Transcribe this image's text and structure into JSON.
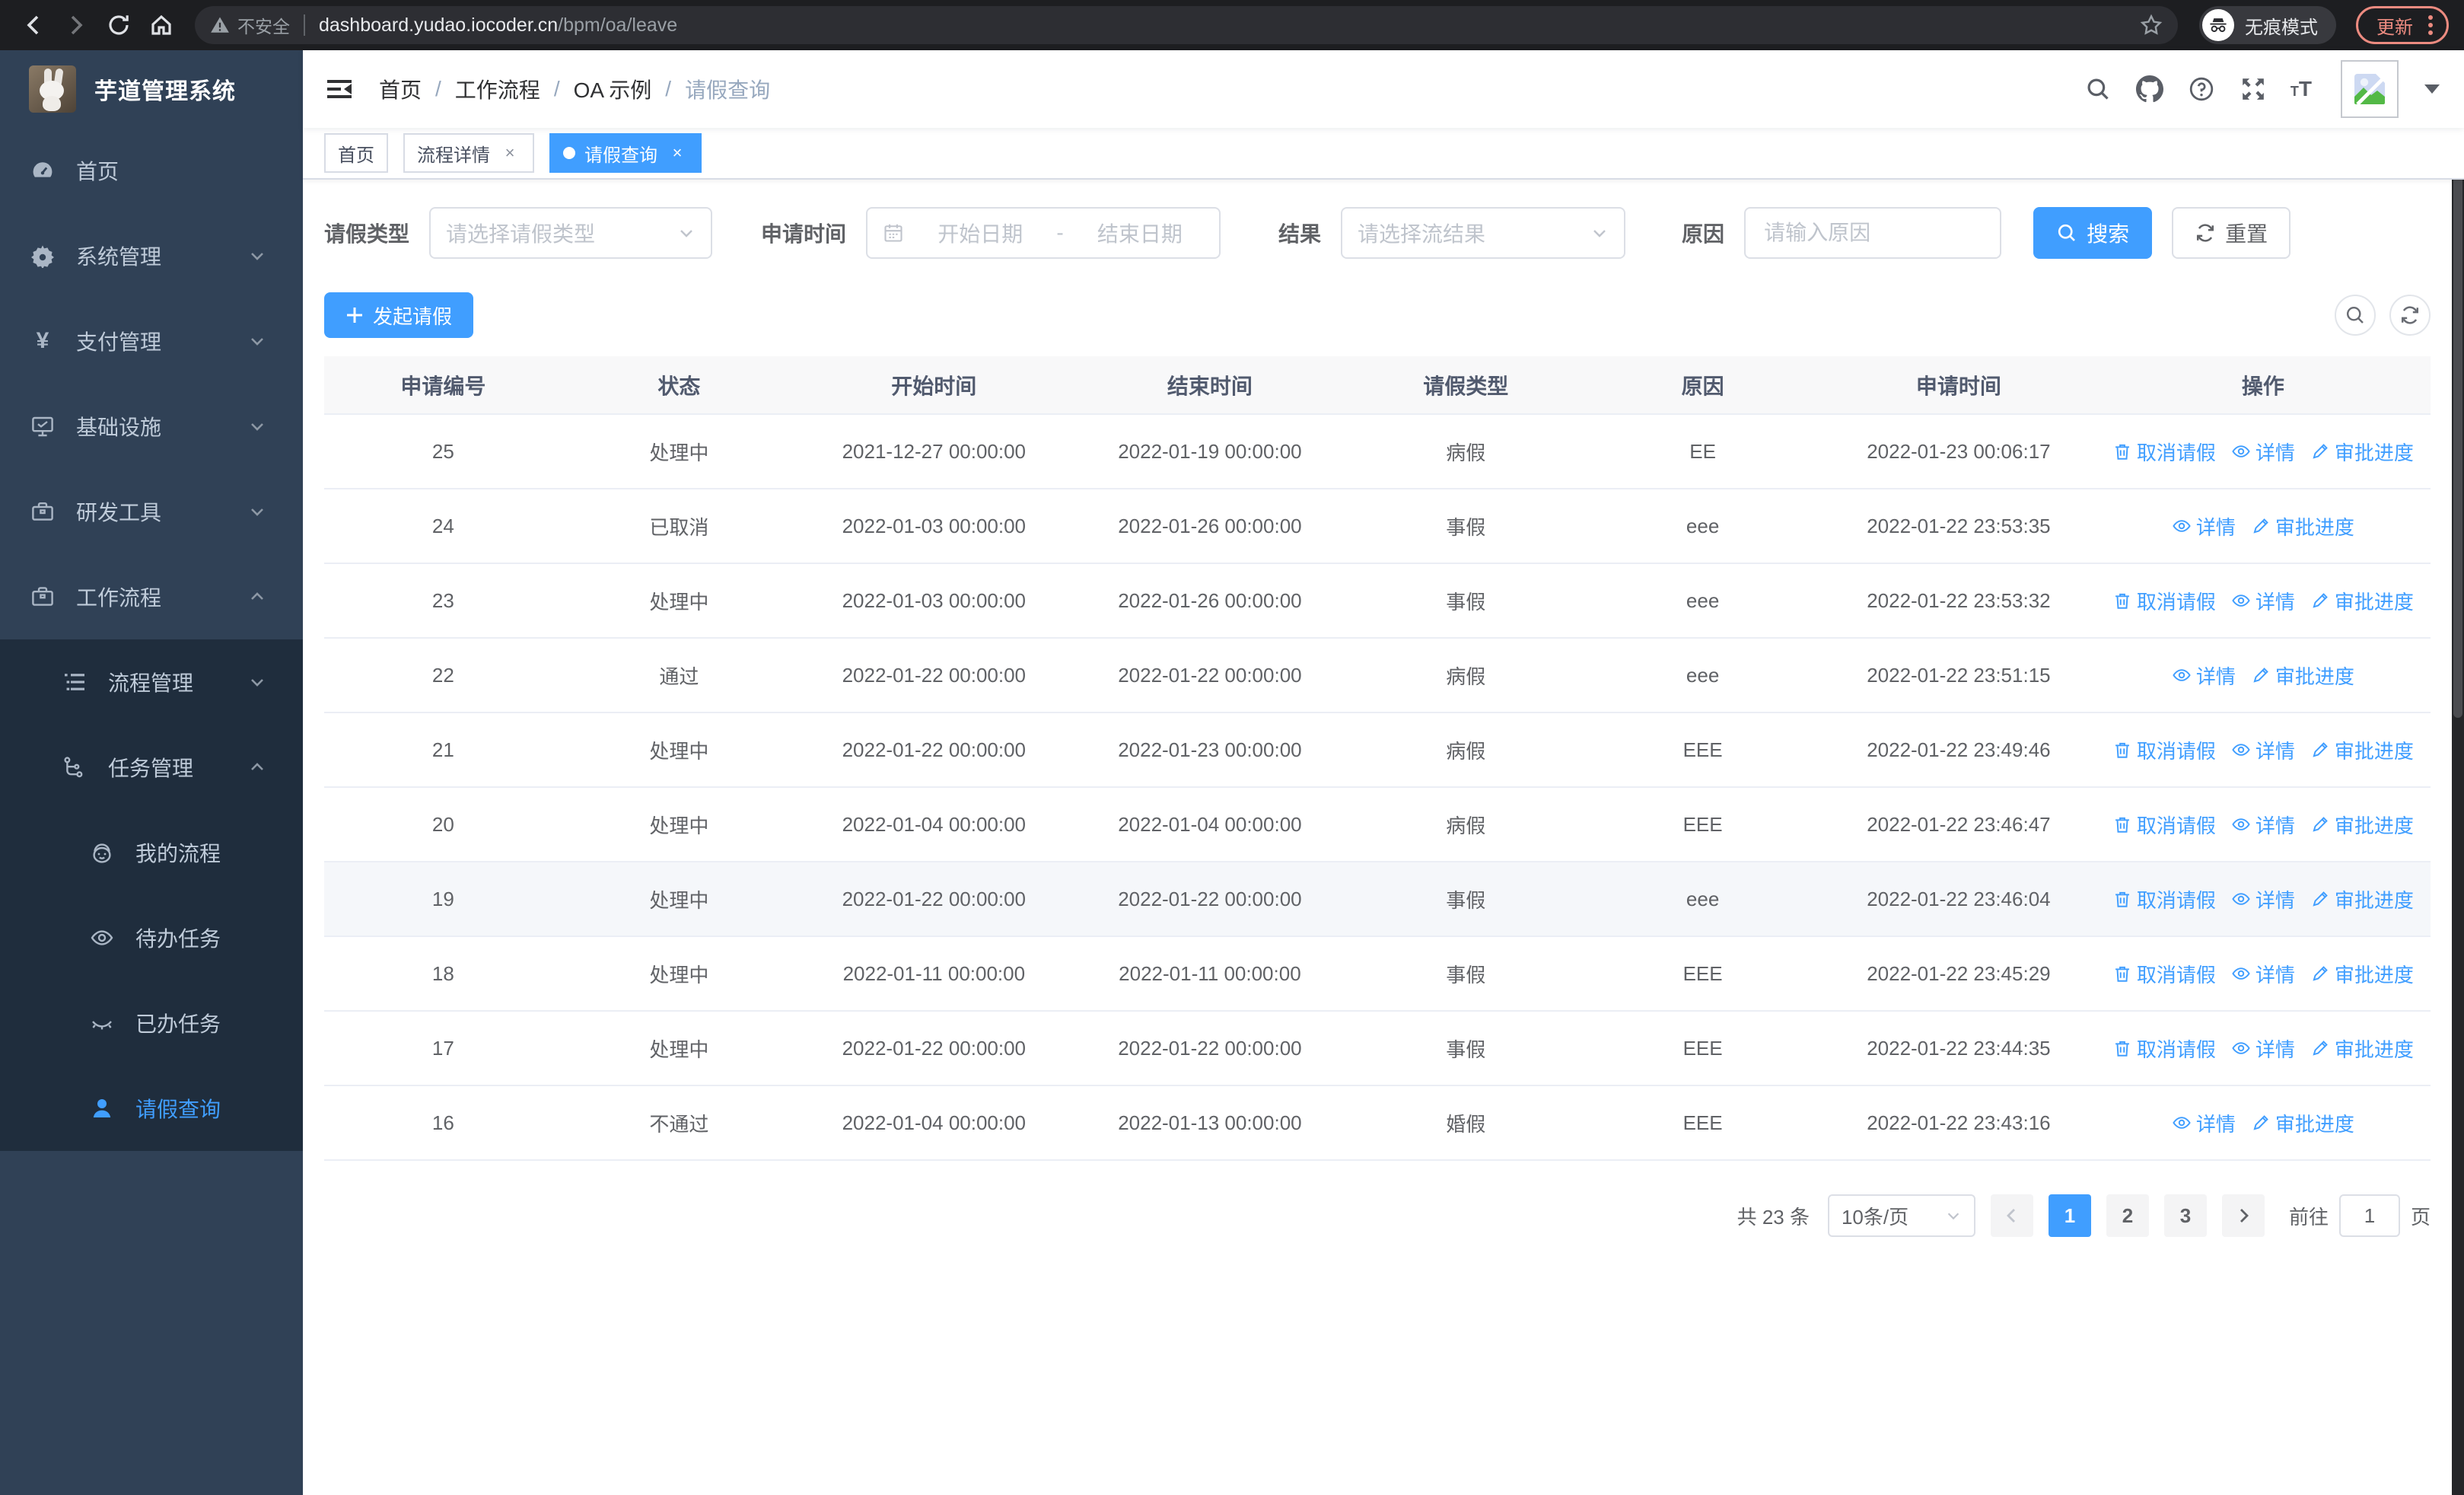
{
  "colors": {
    "accent": "#409eff",
    "sidebar_bg": "#304156",
    "submenu_bg": "#1f2d3d",
    "update_badge": "#ec8b80",
    "header_bg": "#f8f8f9"
  },
  "browser": {
    "security_label": "不安全",
    "url_host": "dashboard.yudao.iocoder.cn",
    "url_path": "/bpm/oa/leave",
    "incognito_label": "无痕模式",
    "update_label": "更新"
  },
  "app": {
    "title": "芋道管理系统"
  },
  "breadcrumb": {
    "separator": "/",
    "items": [
      "首页",
      "工作流程",
      "OA 示例",
      "请假查询"
    ]
  },
  "tags": {
    "home": "首页",
    "process_detail": "流程详情",
    "leave_query": "请假查询",
    "close": "×"
  },
  "sidebar": {
    "items": [
      {
        "label": "首页"
      },
      {
        "label": "系统管理"
      },
      {
        "label": "支付管理"
      },
      {
        "label": "基础设施"
      },
      {
        "label": "研发工具"
      },
      {
        "label": "工作流程"
      },
      {
        "label": "流程管理"
      },
      {
        "label": "任务管理"
      },
      {
        "label": "我的流程"
      },
      {
        "label": "待办任务"
      },
      {
        "label": "已办任务"
      },
      {
        "label": "请假查询"
      }
    ],
    "yen_glyph": "¥"
  },
  "filters": {
    "leave_type_label": "请假类型",
    "leave_type_placeholder": "请选择请假类型",
    "apply_time_label": "申请时间",
    "date_start_placeholder": "开始日期",
    "date_separator": "-",
    "date_end_placeholder": "结束日期",
    "result_label": "结果",
    "result_placeholder": "请选择流结果",
    "reason_label": "原因",
    "reason_placeholder": "请输入原因",
    "search_button": "搜索",
    "reset_button": "重置"
  },
  "toolbar": {
    "create_button": "发起请假"
  },
  "table": {
    "columns": [
      "申请编号",
      "状态",
      "开始时间",
      "结束时间",
      "请假类型",
      "原因",
      "申请时间",
      "操作"
    ],
    "actions": {
      "cancel": "取消请假",
      "detail": "详情",
      "progress": "审批进度"
    },
    "rows": [
      {
        "id": "25",
        "status": "处理中",
        "start": "2021-12-27 00:00:00",
        "end": "2022-01-19 00:00:00",
        "type": "病假",
        "reason": "EE",
        "applied": "2022-01-23 00:06:17"
      },
      {
        "id": "24",
        "status": "已取消",
        "start": "2022-01-03 00:00:00",
        "end": "2022-01-26 00:00:00",
        "type": "事假",
        "reason": "eee",
        "applied": "2022-01-22 23:53:35"
      },
      {
        "id": "23",
        "status": "处理中",
        "start": "2022-01-03 00:00:00",
        "end": "2022-01-26 00:00:00",
        "type": "事假",
        "reason": "eee",
        "applied": "2022-01-22 23:53:32"
      },
      {
        "id": "22",
        "status": "通过",
        "start": "2022-01-22 00:00:00",
        "end": "2022-01-22 00:00:00",
        "type": "病假",
        "reason": "eee",
        "applied": "2022-01-22 23:51:15"
      },
      {
        "id": "21",
        "status": "处理中",
        "start": "2022-01-22 00:00:00",
        "end": "2022-01-23 00:00:00",
        "type": "病假",
        "reason": "EEE",
        "applied": "2022-01-22 23:49:46"
      },
      {
        "id": "20",
        "status": "处理中",
        "start": "2022-01-04 00:00:00",
        "end": "2022-01-04 00:00:00",
        "type": "病假",
        "reason": "EEE",
        "applied": "2022-01-22 23:46:47"
      },
      {
        "id": "19",
        "status": "处理中",
        "start": "2022-01-22 00:00:00",
        "end": "2022-01-22 00:00:00",
        "type": "事假",
        "reason": "eee",
        "applied": "2022-01-22 23:46:04"
      },
      {
        "id": "18",
        "status": "处理中",
        "start": "2022-01-11 00:00:00",
        "end": "2022-01-11 00:00:00",
        "type": "事假",
        "reason": "EEE",
        "applied": "2022-01-22 23:45:29"
      },
      {
        "id": "17",
        "status": "处理中",
        "start": "2022-01-22 00:00:00",
        "end": "2022-01-22 00:00:00",
        "type": "事假",
        "reason": "EEE",
        "applied": "2022-01-22 23:44:35"
      },
      {
        "id": "16",
        "status": "不通过",
        "start": "2022-01-04 00:00:00",
        "end": "2022-01-13 00:00:00",
        "type": "婚假",
        "reason": "EEE",
        "applied": "2022-01-22 23:43:16"
      }
    ]
  },
  "pagination": {
    "total": "共 23 条",
    "page_size": "10条/页",
    "pages": [
      "1",
      "2",
      "3"
    ],
    "active_page": "1",
    "goto_label": "前往",
    "goto_value": "1",
    "page_unit": "页"
  }
}
